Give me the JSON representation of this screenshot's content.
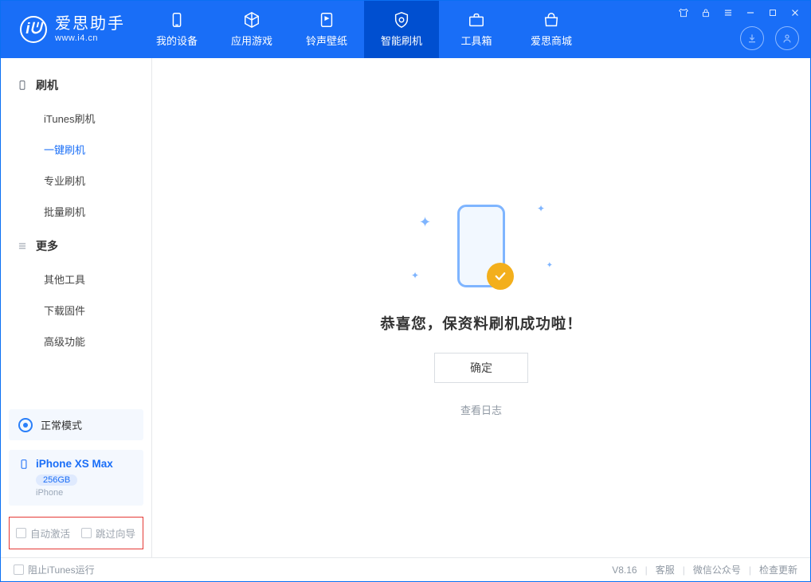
{
  "header": {
    "logo_main": "爱思助手",
    "logo_sub": "www.i4.cn",
    "nav": [
      {
        "label": "我的设备"
      },
      {
        "label": "应用游戏"
      },
      {
        "label": "铃声壁纸"
      },
      {
        "label": "智能刷机"
      },
      {
        "label": "工具箱"
      },
      {
        "label": "爱思商城"
      }
    ]
  },
  "sidebar": {
    "group1_title": "刷机",
    "group1_items": [
      "iTunes刷机",
      "一键刷机",
      "专业刷机",
      "批量刷机"
    ],
    "group2_title": "更多",
    "group2_items": [
      "其他工具",
      "下载固件",
      "高级功能"
    ],
    "mode": "正常模式",
    "device_name": "iPhone XS Max",
    "device_cap": "256GB",
    "device_type": "iPhone",
    "opt_auto_activate": "自动激活",
    "opt_skip_guide": "跳过向导"
  },
  "main": {
    "message": "恭喜您，保资料刷机成功啦！",
    "ok": "确定",
    "view_log": "查看日志"
  },
  "statusbar": {
    "block_itunes": "阻止iTunes运行",
    "version": "V8.16",
    "links": [
      "客服",
      "微信公众号",
      "检查更新"
    ]
  }
}
